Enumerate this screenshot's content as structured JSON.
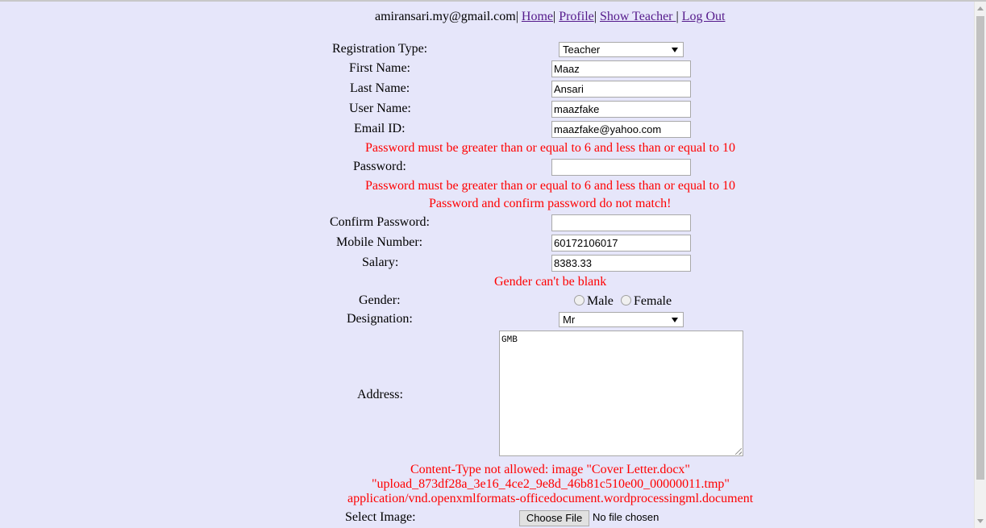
{
  "header": {
    "user_email": "amiransari.my@gmail.com",
    "sep": "|",
    "links": {
      "home": "Home",
      "profile": "Profile",
      "show_teacher": "Show Teacher ",
      "logout": "Log Out"
    }
  },
  "form": {
    "registration_type": {
      "label": "Registration Type:",
      "value": "Teacher"
    },
    "first_name": {
      "label": "First Name:",
      "value": "Maaz"
    },
    "last_name": {
      "label": "Last Name:",
      "value": "Ansari"
    },
    "user_name": {
      "label": "User Name:",
      "value": "maazfake"
    },
    "email": {
      "label": "Email ID:",
      "value": "maazfake@yahoo.com"
    },
    "password": {
      "error": "Password must be greater than or equal to 6 and less than or equal to 10",
      "label": "Password:",
      "value": ""
    },
    "confirm_password": {
      "error_length": "Password must be greater than or equal to 6 and less than or equal to 10",
      "error_match": "Password and confirm password do not match!",
      "label": "Confirm Password:",
      "value": ""
    },
    "mobile": {
      "label": "Mobile Number:",
      "value": "60172106017"
    },
    "salary": {
      "label": "Salary:",
      "value": "8383.33"
    },
    "gender": {
      "error": "Gender can't be blank",
      "label": "Gender:",
      "options": [
        "Male",
        "Female"
      ]
    },
    "designation": {
      "label": "Designation:",
      "value": "Mr"
    },
    "address": {
      "label": "Address:",
      "value": "GMB"
    },
    "image": {
      "error_line1": "Content-Type not allowed: image \"Cover Letter.docx\"",
      "error_line2": "\"upload_873df28a_3e16_4ce2_9e8d_46b81c510e00_00000011.tmp\"",
      "error_line3": "application/vnd.openxmlformats-officedocument.wordprocessingml.document",
      "label": "Select Image:",
      "button": "Choose File",
      "status": "No file chosen"
    }
  },
  "colors": {
    "background": "#e6e6fa",
    "error": "#ff0000",
    "link": "#551a8b"
  }
}
